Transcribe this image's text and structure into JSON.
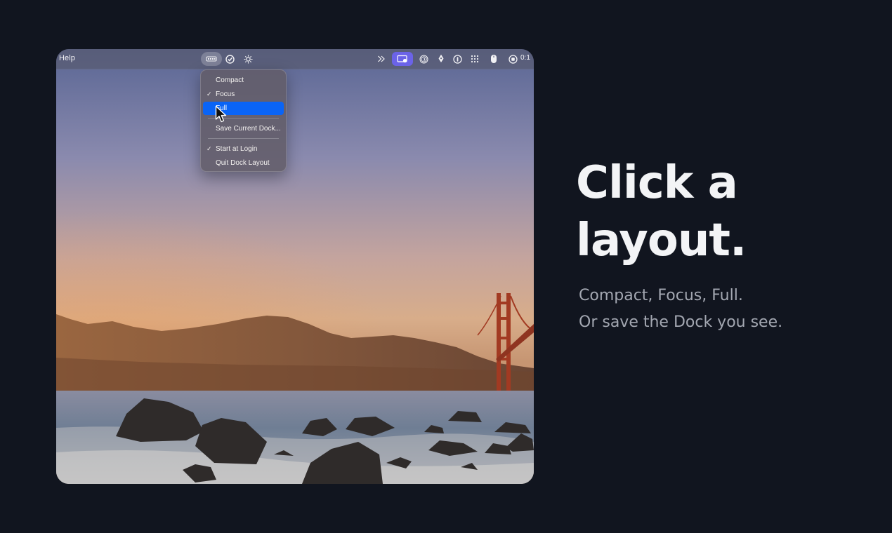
{
  "menubar": {
    "app_menu": "Help",
    "clock": "0:1",
    "icons": [
      "dock-layout-icon",
      "checkmark-circle-icon",
      "sun-icon",
      "chevron-double-right-icon",
      "screen-share-icon",
      "fingerprint-icon",
      "rocket-icon",
      "password-icon",
      "grid-dots-icon",
      "mouse-icon",
      "record-icon"
    ]
  },
  "dropdown": {
    "items": [
      {
        "label": "Compact",
        "checked": false,
        "selected": false
      },
      {
        "label": "Focus",
        "checked": true,
        "selected": false
      },
      {
        "label": "Full",
        "checked": false,
        "selected": true
      },
      {
        "label": "Save Current Dock...",
        "checked": false,
        "selected": false
      },
      {
        "label": "Start at Login",
        "checked": true,
        "selected": false
      },
      {
        "label": "Quit Dock Layout",
        "checked": false,
        "selected": false
      }
    ],
    "check_glyph": "✓"
  },
  "promo": {
    "headline_line1": "Click a",
    "headline_line2": "layout.",
    "sub_line1": "Compact, Focus, Full.",
    "sub_line2": "Or save the Dock you see."
  },
  "colors": {
    "page_background": "#11151f",
    "selection": "#0a64f6",
    "menubar_highlight": "#6b63e8",
    "headline": "#f3f4f6",
    "subcopy": "#a3a7b1"
  }
}
